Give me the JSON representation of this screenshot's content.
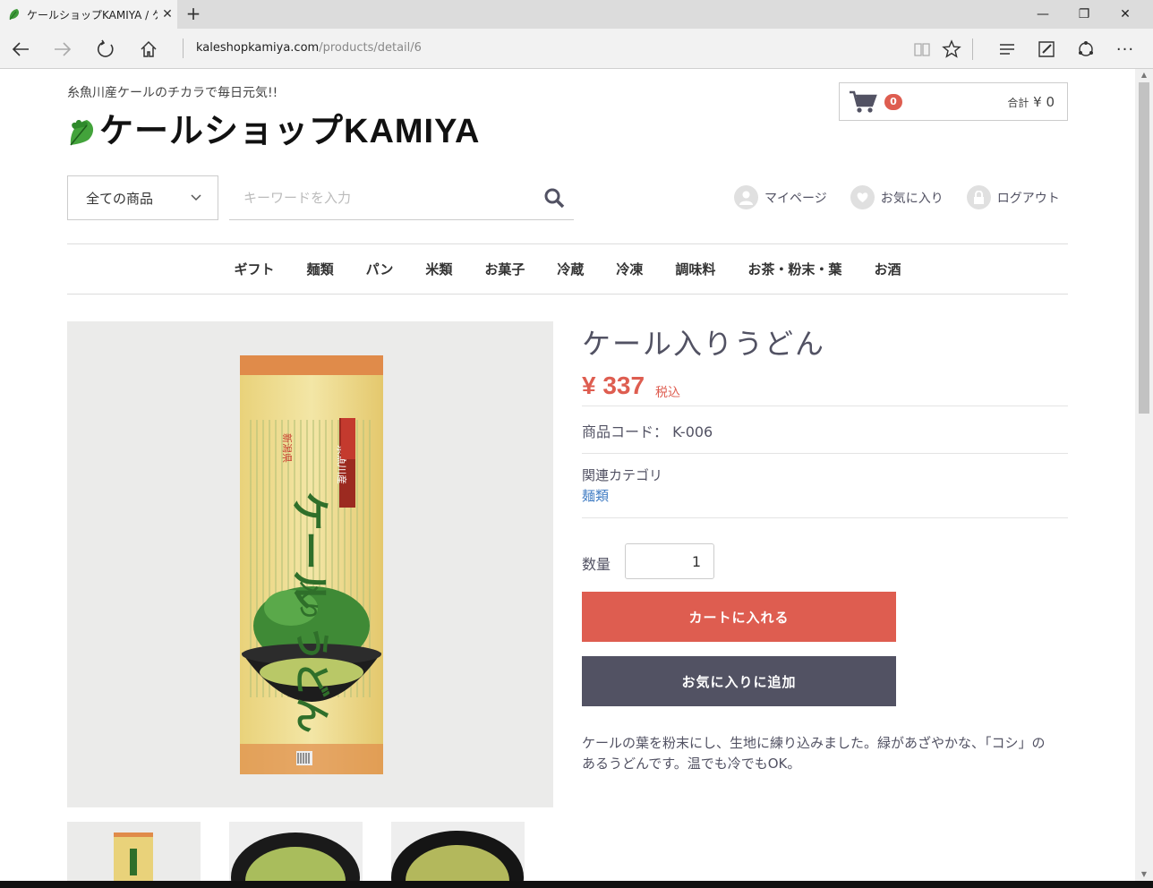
{
  "browser": {
    "tab_title": "ケールショップKAMIYA / ケ",
    "address_domain": "kaleshopkamiya.com",
    "address_path": "/products/detail/6"
  },
  "header": {
    "tagline": "糸魚川産ケールのチカラで毎日元気!!",
    "logo_text": "ケールショップKAMIYA",
    "cart": {
      "count": "0",
      "total_label": "合計",
      "total_value": "¥ 0"
    }
  },
  "search": {
    "category_selected": "全ての商品",
    "placeholder": "キーワードを入力"
  },
  "user_nav": [
    {
      "label": "マイページ",
      "icon": "user-icon"
    },
    {
      "label": "お気に入り",
      "icon": "heart-icon"
    },
    {
      "label": "ログアウト",
      "icon": "lock-icon"
    }
  ],
  "global_nav": [
    "ギフト",
    "麺類",
    "パン",
    "米類",
    "お菓子",
    "冷蔵",
    "冷凍",
    "調味料",
    "お茶・粉末・葉",
    "お酒"
  ],
  "product": {
    "name": "ケール入りうどん",
    "price": "¥ 337",
    "tax_label": "税込",
    "code_label": "商品コード：",
    "code": "K-006",
    "related_category_label": "関連カテゴリ",
    "related_category": "麺類",
    "quantity_label": "数量",
    "quantity": "1",
    "add_to_cart": "カートに入れる",
    "add_to_favorites": "お気に入りに追加",
    "description": "ケールの葉を粉末にし、生地に練り込みました。緑があざやかな、「コシ」のあるうどんです。温でも冷でもOK。",
    "package_labels": {
      "vertical_tag": "新潟県",
      "origin": "糸魚川産",
      "name_main": "ケール",
      "name_small": "入り",
      "name_end": "うどん"
    }
  },
  "colors": {
    "accent": "#de5d50",
    "dark_button": "#525263",
    "link": "#437ec4"
  }
}
